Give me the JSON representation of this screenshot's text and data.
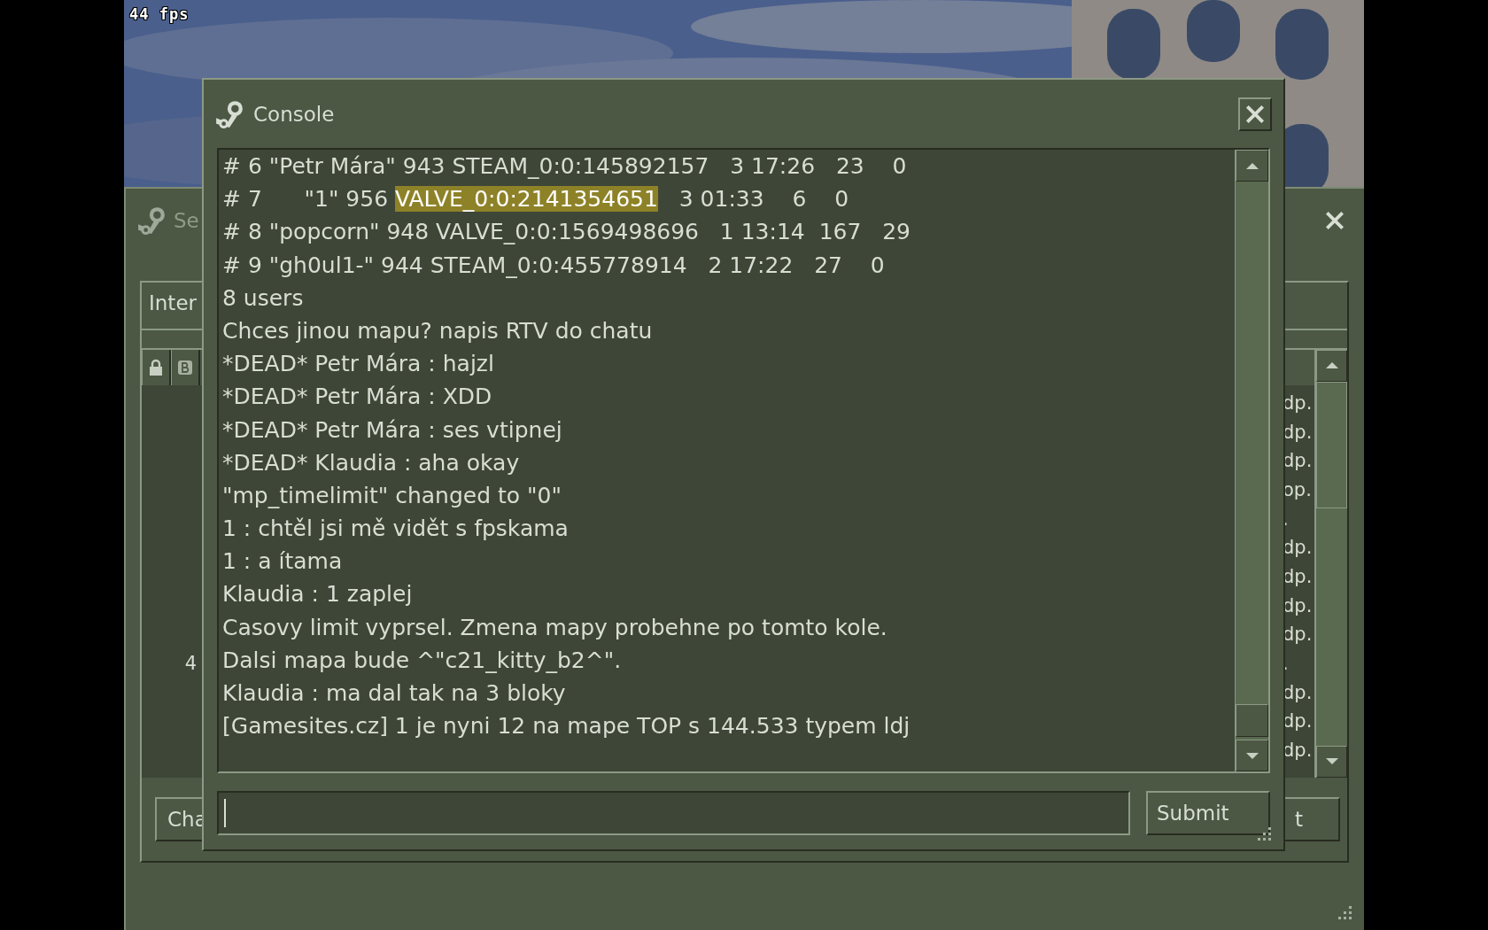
{
  "overlay": {
    "fps": "44 fps"
  },
  "background_window": {
    "title": "Se",
    "tabs": [
      {
        "label": "Inter",
        "selected": true
      }
    ],
    "list": {
      "rows": [
        {
          "column_last": "dp."
        },
        {
          "column_last": "dp."
        },
        {
          "column_last": "dp."
        },
        {
          "column_last": "op."
        },
        {
          "column_last": "."
        },
        {
          "column_last": "dp."
        },
        {
          "column_last": "dp."
        },
        {
          "column_last": "dp."
        },
        {
          "column_last": "dp."
        },
        {
          "column_1": "4",
          "column_last": "."
        },
        {
          "column_last": "dp."
        },
        {
          "column_last": "dp."
        },
        {
          "column_last": "dp."
        }
      ]
    },
    "buttons": [
      "Cha",
      "t"
    ]
  },
  "console": {
    "title": "Console",
    "lines": [
      {
        "segments": [
          {
            "text": "# 6 \"Petr Mára\" 943 STEAM_0:0:145892157   3 17:26   23    0",
            "selected": false
          }
        ]
      },
      {
        "segments": [
          {
            "text": "# 7      \"1\" 956 ",
            "selected": false
          },
          {
            "text": "VALVE_0:0:2141354651",
            "selected": true
          },
          {
            "text": "   3 01:33    6    0",
            "selected": false
          }
        ]
      },
      {
        "segments": [
          {
            "text": "# 8 \"popcorn\" 948 VALVE_0:0:1569498696   1 13:14  167   29",
            "selected": false
          }
        ]
      },
      {
        "segments": [
          {
            "text": "# 9 \"gh0ul1-\" 944 STEAM_0:0:455778914   2 17:22   27    0",
            "selected": false
          }
        ]
      },
      {
        "segments": [
          {
            "text": "8 users",
            "selected": false
          }
        ]
      },
      {
        "segments": [
          {
            "text": "Chces jinou mapu? napis RTV do chatu",
            "selected": false
          }
        ]
      },
      {
        "segments": [
          {
            "text": "*DEAD* Petr Mára : hajzl",
            "selected": false
          }
        ]
      },
      {
        "segments": [
          {
            "text": "*DEAD* Petr Mára : XDD",
            "selected": false
          }
        ]
      },
      {
        "segments": [
          {
            "text": "*DEAD* Petr Mára : ses vtipnej",
            "selected": false
          }
        ]
      },
      {
        "segments": [
          {
            "text": "*DEAD* Klaudia : aha okay",
            "selected": false
          }
        ]
      },
      {
        "segments": [
          {
            "text": "\"mp_timelimit\" changed to \"0\"",
            "selected": false
          }
        ]
      },
      {
        "segments": [
          {
            "text": "1 : chtěl jsi mě vidět s fpskama",
            "selected": false
          }
        ]
      },
      {
        "segments": [
          {
            "text": "1 : a ítama",
            "selected": false
          }
        ]
      },
      {
        "segments": [
          {
            "text": "Klaudia : 1 zaplej",
            "selected": false
          }
        ]
      },
      {
        "segments": [
          {
            "text": "Casovy limit vyprsel. Zmena mapy probehne po tomto kole.",
            "selected": false
          }
        ]
      },
      {
        "segments": [
          {
            "text": "Dalsi mapa bude ^\"c21_kitty_b2^\".",
            "selected": false
          }
        ]
      },
      {
        "segments": [
          {
            "text": "Klaudia : ma dal tak na 3 bloky",
            "selected": false
          }
        ]
      },
      {
        "segments": [
          {
            "text": "[Gamesites.cz] 1 je nyni 12 na mape TOP s 144.533 typem ldj",
            "selected": false
          }
        ]
      }
    ],
    "submit": "Submit"
  }
}
